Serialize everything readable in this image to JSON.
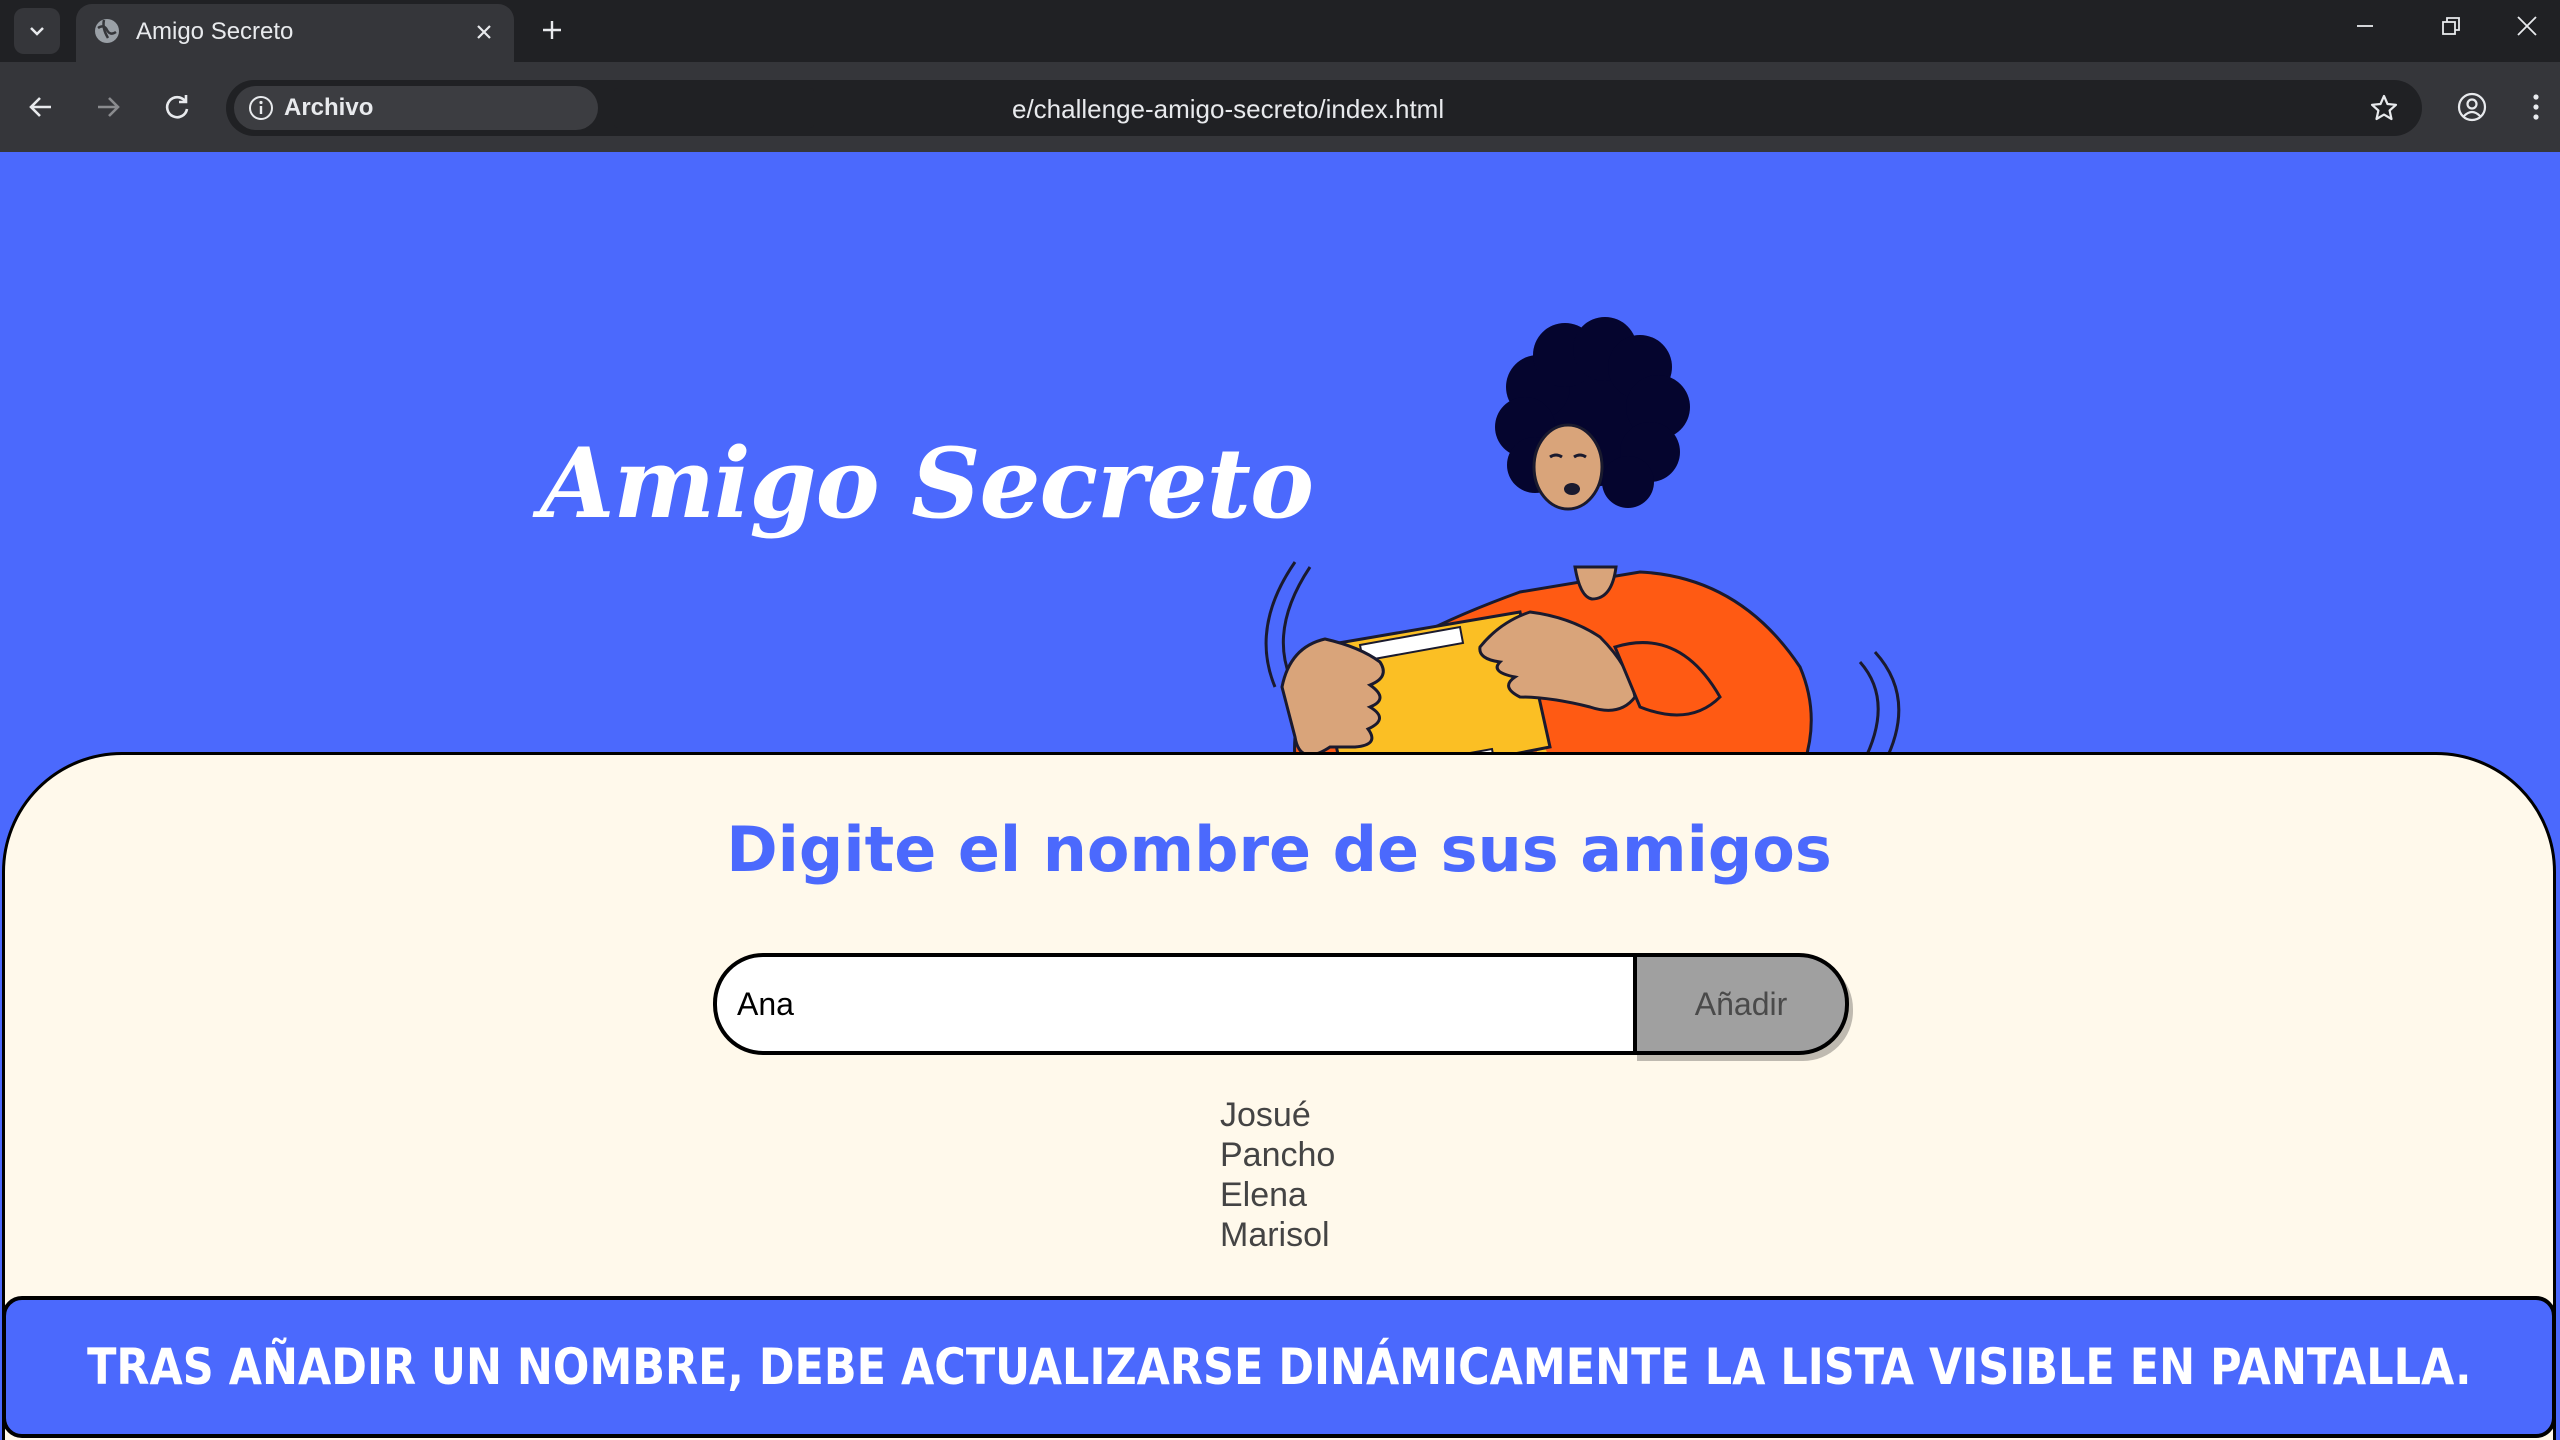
{
  "browser": {
    "tab_title": "Amigo Secreto",
    "site_chip_label": "Archivo",
    "url_visible": "e/challenge-amigo-secreto/index.html"
  },
  "page": {
    "hero_title": "Amigo Secreto",
    "section_title": "Digite el nombre de sus amigos",
    "input_value": "Ana",
    "add_button_label": "Añadir",
    "friends": [
      "Josué",
      "Pancho",
      "Elena",
      "Marisol"
    ]
  },
  "caption": "TRAS AÑADIR UN NOMBRE, DEBE ACTUALIZARSE DINÁMICAMENTE LA LISTA VISIBLE EN PANTALLA.",
  "colors": {
    "primary_blue": "#4b69fd",
    "card_background": "#fff9eb",
    "button_gray": "#a0a0a0",
    "illustration_orange": "#ff5a13",
    "illustration_yellow": "#fbbf24"
  },
  "icons": [
    "tab-list-icon",
    "globe-icon",
    "close-icon",
    "plus-icon",
    "minimize-icon",
    "restore-icon",
    "back-icon",
    "forward-icon",
    "reload-icon",
    "info-icon",
    "star-icon",
    "profile-icon",
    "menu-icon"
  ]
}
